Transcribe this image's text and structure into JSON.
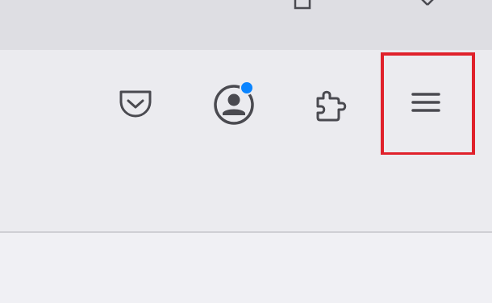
{
  "window_controls": {
    "restore_icon": "restore-icon",
    "close_icon": "close-icon"
  },
  "toolbar": {
    "buttons": [
      {
        "name": "pocket",
        "icon": "pocket-icon"
      },
      {
        "name": "account",
        "icon": "account-icon",
        "badge": true,
        "badge_color": "#0a84ff"
      },
      {
        "name": "extensions",
        "icon": "puzzle-icon"
      },
      {
        "name": "menu",
        "icon": "hamburger-menu-icon",
        "highlighted": true
      }
    ]
  },
  "colors": {
    "titlebar_bg": "#dedee3",
    "toolbar_bg": "#ebebef",
    "icon_color": "#4a4a50",
    "highlight_border": "#e0212b",
    "badge": "#0a84ff"
  }
}
